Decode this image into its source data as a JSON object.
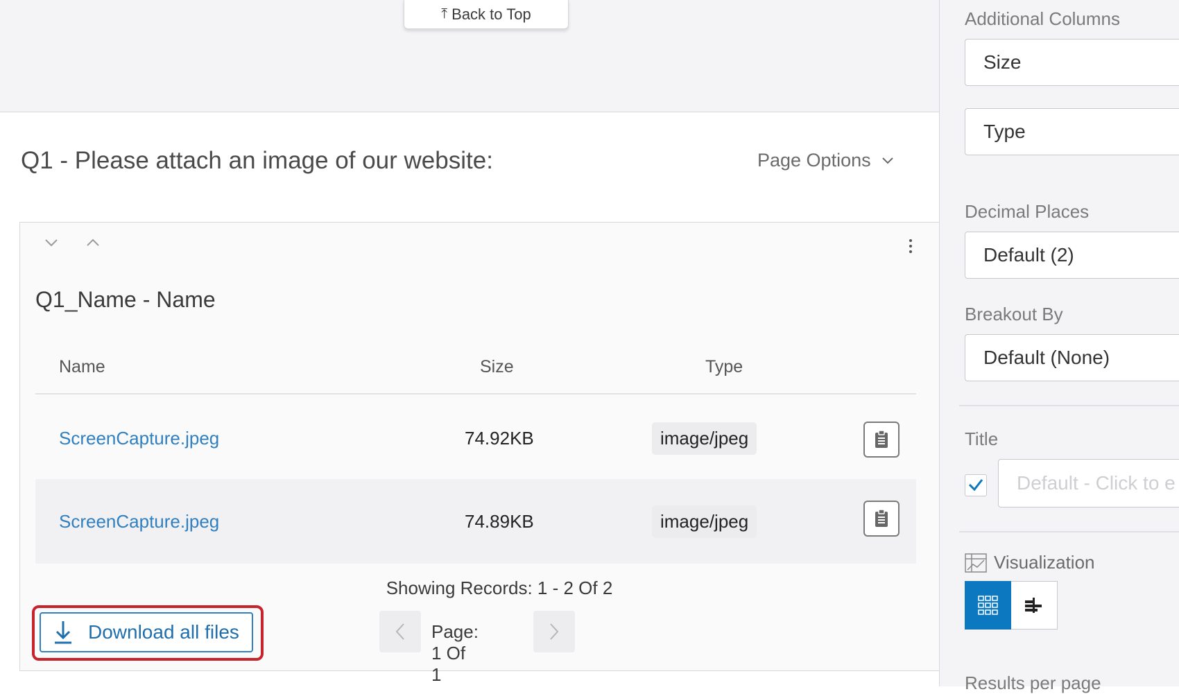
{
  "main": {
    "back_to_top": "Back to Top",
    "question_title": "Q1 - Please attach an image of our website:",
    "page_options": "Page Options",
    "card": {
      "title": "Q1_Name - Name",
      "columns": [
        "Name",
        "Size",
        "Type"
      ],
      "rows": [
        {
          "name": "ScreenCapture.jpeg",
          "size": "74.92KB",
          "type": "image/jpeg"
        },
        {
          "name": "ScreenCapture.jpeg",
          "size": "74.89KB",
          "type": "image/jpeg"
        }
      ],
      "records": "Showing Records: 1 - 2 Of 2",
      "download_label": "Download all files",
      "page_text": "Page: 1 Of 1"
    }
  },
  "sidebar": {
    "additional_columns_label": "Additional Columns",
    "additional_columns": [
      "Size",
      "Type"
    ],
    "decimal_places_label": "Decimal Places",
    "decimal_places_value": "Default (2)",
    "breakout_label": "Breakout By",
    "breakout_value": "Default (None)",
    "title_label": "Title",
    "title_checked": true,
    "title_placeholder": "Default - Click to e",
    "visualization_label": "Visualization",
    "results_per_page_label": "Results per page"
  },
  "colors": {
    "accent": "#0b78bf",
    "link": "#2f7fc1",
    "highlight_border": "#c8232c",
    "panel_bg": "#f4f4f6"
  }
}
